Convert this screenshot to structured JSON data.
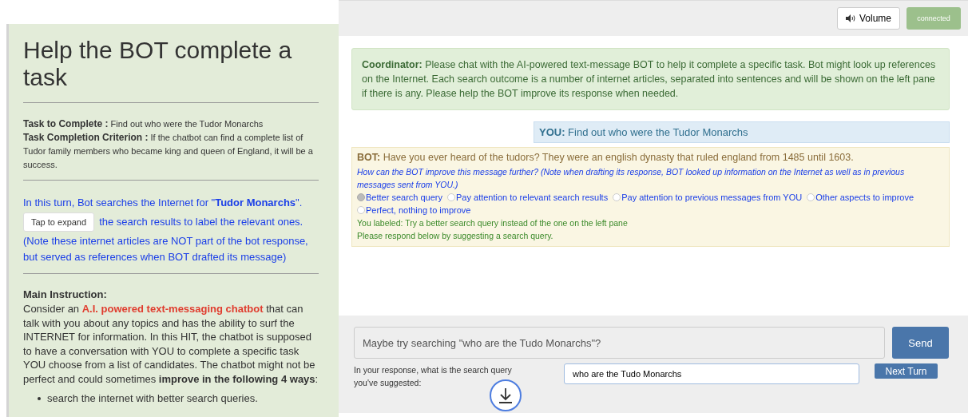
{
  "left_panel": {
    "title": "Help the BOT complete a task",
    "task": {
      "label": "Task to Complete :",
      "value": "Find out who were the Tudor Monarchs"
    },
    "criterion": {
      "label": "Task Completion Criterion :",
      "value": "If the chatbot can find a complete list of Tudor family members who became king and queen of England, it will be a success."
    },
    "search_note": "In this turn, Bot searches the Internet for \"**Tudor Monarchs**\".",
    "expand_button": "Tap to expand",
    "expand_after": "the search results to label the relevant ones.",
    "reference_note": "(Note these internet articles are NOT part of the bot response, but served as references when BOT drafted its message)",
    "instruction_heading": "Main Instruction:",
    "instruction_parts": [
      {
        "kind": "plain",
        "text": "Consider an "
      },
      {
        "kind": "highlight",
        "text": "A.I. powered text-messaging chatbot"
      },
      {
        "kind": "plain",
        "text": " that can talk with you about any topics and has the ability to surf the INTERNET for information. In this HIT, the chatbot is supposed to have a conversation with YOU to complete a specific task YOU choose from a list of candidates. The chatbot might not be perfect and could sometimes "
      },
      {
        "kind": "bold",
        "text": "improve in the following 4 ways"
      },
      {
        "kind": "plain",
        "text": ":"
      }
    ],
    "bullets": [
      "search the internet with better search queries."
    ]
  },
  "top_bar": {
    "volume_button": "Volume",
    "status": "connected"
  },
  "chat": [
    {
      "kind": "coordinator",
      "speaker": "Coordinator:",
      "text": "Please chat with the AI-powered text-message BOT to help it complete a specific task. Bot might look up references on the Internet. Each search outcome is a number of internet articles, separated into sentences and will be shown on the left pane if there is any. Please help the BOT improve its response when needed."
    },
    {
      "kind": "user",
      "speaker": "YOU:",
      "text": "Find out who were the Tudor Monarchs"
    },
    {
      "kind": "bot",
      "speaker": "BOT:",
      "text": "Have you ever heard of the tudors? They were an english dynasty that ruled england from 1485 until 1603.",
      "question": "How can the BOT improve this message further? (Note when drafting its response, BOT looked up information on the Internet as well as in previous messages sent from YOU.)",
      "options": [
        {
          "label": "Better search query",
          "selected": true
        },
        {
          "label": "Pay attention to relevant search results",
          "selected": false
        },
        {
          "label": "Pay attention to previous messages from YOU",
          "selected": false
        },
        {
          "label": "Other aspects to improve",
          "selected": false
        },
        {
          "label": "Perfect, nothing to improve",
          "selected": false
        }
      ],
      "feedback": [
        "You labeled: Try a better search query instead of the one on the left pane",
        "Please respond below by suggesting a search query."
      ]
    }
  ],
  "composer": {
    "message": "Maybe try searching \"who are the Tudo Monarchs\"?",
    "send_button": "Send",
    "query_label": "In your response, what is the search query you've suggested:",
    "query_value": "who are the Tudo Monarchs",
    "next_button": "Next Turn"
  }
}
